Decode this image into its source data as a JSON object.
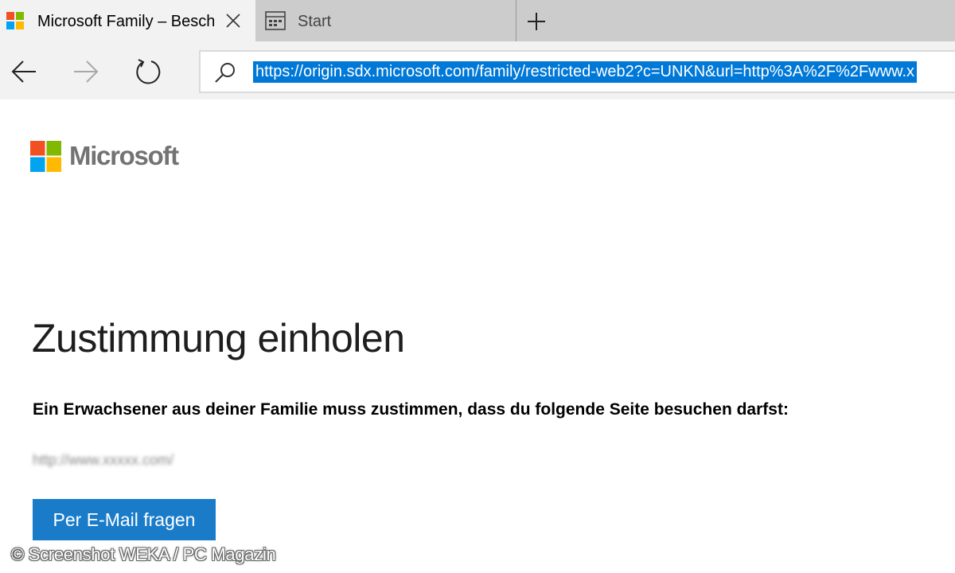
{
  "tabs": [
    {
      "label": "Microsoft Family – Beschränkte Website",
      "favicon": "microsoft-logo-icon",
      "active": true,
      "close_icon": "close-icon"
    },
    {
      "label": "Start",
      "favicon": "start-page-icon",
      "active": false
    }
  ],
  "new_tab_icon": "plus-icon",
  "nav": {
    "back_icon": "back-arrow-icon",
    "forward_icon": "forward-arrow-icon",
    "refresh_icon": "refresh-icon",
    "search_icon": "search-icon",
    "url": "https://origin.sdx.microsoft.com/family/restricted-web2?c=UNKN&url=http%3A%2F%2Fwww.x"
  },
  "page": {
    "brand": "Microsoft",
    "heading": "Zustimmung einholen",
    "message": "Ein Erwachsener aus deiner Familie muss zustimmen, dass du folgende Seite besuchen darfst:",
    "blocked_url": "http://www.xxxxx.com/",
    "ask_button": "Per E-Mail fragen"
  },
  "watermark": "© Screenshot WEKA / PC Magazin",
  "colors": {
    "accent": "#0078d7",
    "button": "#1a7cc9",
    "logo_red": "#f25022",
    "logo_green": "#7fba00",
    "logo_blue": "#00a4ef",
    "logo_yellow": "#ffb900"
  }
}
